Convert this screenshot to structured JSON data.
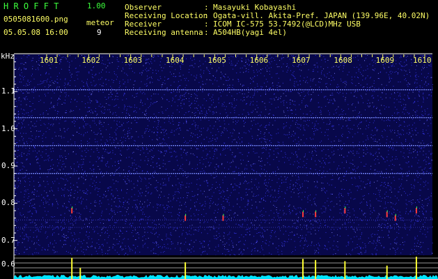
{
  "header": {
    "app_name": "H R O F F T",
    "version": "1.00",
    "filename": "0505081600.png",
    "datetime": "05.05.08 16:00",
    "meteor_label": "meteor",
    "meteor_count": "9",
    "fields": [
      {
        "key": "Observer",
        "sep": ":",
        "value": "Masayuki Kobayashi"
      },
      {
        "key": "Receiving Location",
        "sep": ":",
        "value": "Ogata-vill. Akita-Pref. JAPAN (139.96E, 40.02N)"
      },
      {
        "key": "Receiver",
        "sep": ":",
        "value": "ICOM IC-575 53.7492(@LCD)MHz USB"
      },
      {
        "key": "Receiving antenna",
        "sep": ":",
        "value": "A504HB(yagi 4el)"
      }
    ]
  },
  "chart_data": {
    "type": "heatmap",
    "ylabel": "kHz",
    "x_ticks": [
      "1601",
      "1602",
      "1603",
      "1604",
      "1605",
      "1606",
      "1607",
      "1608",
      "1609",
      "1610"
    ],
    "y_ticks": [
      "1.1",
      "1.0",
      "0.9",
      "0.8",
      "0.7"
    ],
    "lower_y_ticks": [
      "0.6"
    ],
    "ylim": [
      0.66,
      1.2
    ],
    "background_color": "#08084a",
    "noise_color": "#3c3cff",
    "carrier_lines_khz": [
      1.105,
      1.03,
      0.955,
      0.88
    ],
    "meteor_echoes": [
      {
        "minute": 1601.6,
        "khz": 0.78
      },
      {
        "minute": 1604.3,
        "khz": 0.76
      },
      {
        "minute": 1605.2,
        "khz": 0.76
      },
      {
        "minute": 1607.1,
        "khz": 0.77
      },
      {
        "minute": 1607.4,
        "khz": 0.77
      },
      {
        "minute": 1608.1,
        "khz": 0.78
      },
      {
        "minute": 1609.1,
        "khz": 0.77
      },
      {
        "minute": 1609.3,
        "khz": 0.76
      },
      {
        "minute": 1609.8,
        "khz": 0.78
      }
    ],
    "activity_spikes": [
      {
        "minute": 1601.6,
        "level": 0.95
      },
      {
        "minute": 1601.8,
        "level": 0.5
      },
      {
        "minute": 1604.3,
        "level": 0.75
      },
      {
        "minute": 1607.1,
        "level": 0.9
      },
      {
        "minute": 1607.4,
        "level": 0.85
      },
      {
        "minute": 1608.1,
        "level": 0.8
      },
      {
        "minute": 1609.1,
        "level": 0.6
      },
      {
        "minute": 1609.8,
        "level": 1.0
      }
    ],
    "line_colors": {
      "ticks": "#ffff66",
      "frame": "#ffffff",
      "grid": "#c8c8c8",
      "baseline": "#00e5ff",
      "spike": "#ffff33"
    }
  }
}
